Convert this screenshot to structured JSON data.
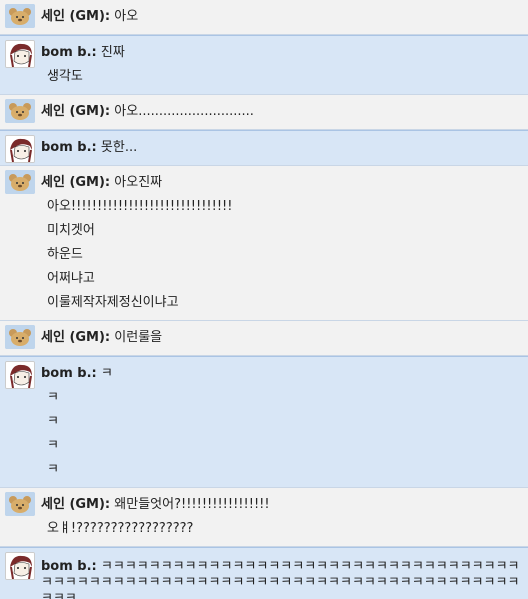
{
  "messages": [
    {
      "sender": "세인 (GM):",
      "type": "gm",
      "lines": [
        "아오"
      ]
    },
    {
      "sender": "bom b.:",
      "type": "bom",
      "lines": [
        "진짜",
        "생각도"
      ]
    },
    {
      "sender": "세인 (GM):",
      "type": "gm",
      "lines": [
        "아오............................"
      ]
    },
    {
      "sender": "bom b.:",
      "type": "bom",
      "lines": [
        "못한..."
      ]
    },
    {
      "sender": "세인 (GM):",
      "type": "gm",
      "lines": [
        "아오진짜",
        "아오!!!!!!!!!!!!!!!!!!!!!!!!!!!!!!!",
        "미치겟어",
        "하운드",
        "어쩌냐고",
        "이룰제작자제정신이냐고"
      ]
    },
    {
      "sender": "세인 (GM):",
      "type": "gm",
      "lines": [
        "이런룰을"
      ]
    },
    {
      "sender": "bom b.:",
      "type": "bom",
      "lines": [
        "ㅋ",
        "ㅋ",
        "ㅋ",
        "ㅋ",
        "ㅋ"
      ]
    },
    {
      "sender": "세인 (GM):",
      "type": "gm",
      "lines": [
        "왜만들엇어?!!!!!!!!!!!!!!!!!",
        "오ㅒ!?????????????????"
      ]
    },
    {
      "sender": "bom b.:",
      "type": "bom",
      "lines": [
        "ㅋㅋㅋㅋㅋㅋㅋㅋㅋㅋㅋㅋㅋㅋㅋㅋㅋㅋㅋㅋㅋㅋㅋㅋㅋㅋㅋㅋㅋㅋㅋㅋㅋㅋㅋㅋㅋㅋㅋㅋㅋㅋㅋㅋㅋㅋㅋㅋㅋㅋㅋㅋㅋㅋㅋㅋㅋㅋㅋㅋㅋㅋㅋㅋㅋㅋㅋㅋㅋㅋㅋㅋㅋㅋㅋㅋㅋㅋ"
      ]
    }
  ]
}
